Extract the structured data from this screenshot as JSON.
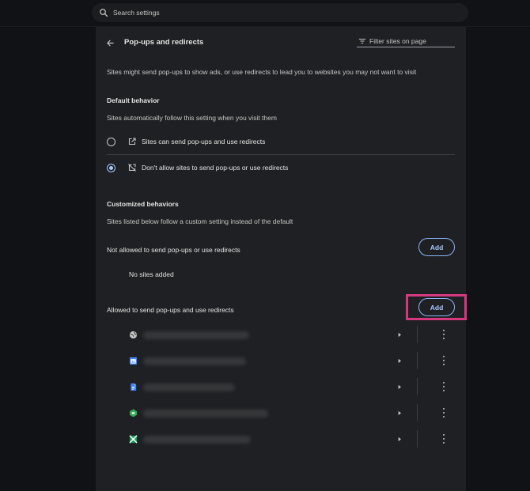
{
  "search": {
    "placeholder": "Search settings"
  },
  "header": {
    "title": "Pop-ups and redirects",
    "filter_placeholder": "Filter sites on page"
  },
  "description": "Sites might send pop-ups to show ads, or use redirects to lead you to websites you may not want to visit",
  "default_behavior": {
    "heading": "Default behavior",
    "subtext": "Sites automatically follow this setting when you visit them",
    "options": [
      {
        "label": "Sites can send pop-ups and use redirects",
        "selected": false,
        "icon": "open-in-new-icon"
      },
      {
        "label": "Don't allow sites to send pop-ups or use redirects",
        "selected": true,
        "icon": "popup-blocked-icon"
      }
    ]
  },
  "customized": {
    "heading": "Customized behaviors",
    "subtext": "Sites listed below follow a custom setting instead of the default",
    "not_allowed": {
      "label": "Not allowed to send pop-ups or use redirects",
      "add_label": "Add",
      "empty_text": "No sites added"
    },
    "allowed": {
      "label": "Allowed to send pop-ups and use redirects",
      "add_label": "Add",
      "sites": [
        {
          "icon": "globe-icon",
          "color": "#c4c7c5"
        },
        {
          "icon": "calendar-icon",
          "color": "#4285f4"
        },
        {
          "icon": "docs-icon",
          "color": "#4285f4"
        },
        {
          "icon": "green-app-icon",
          "color": "#34a853"
        },
        {
          "icon": "sheets-icon",
          "color": "#0f9d58"
        }
      ]
    }
  },
  "colors": {
    "accent": "#a8c7fa",
    "highlight": "#d6387f",
    "panel": "#1f2023"
  }
}
